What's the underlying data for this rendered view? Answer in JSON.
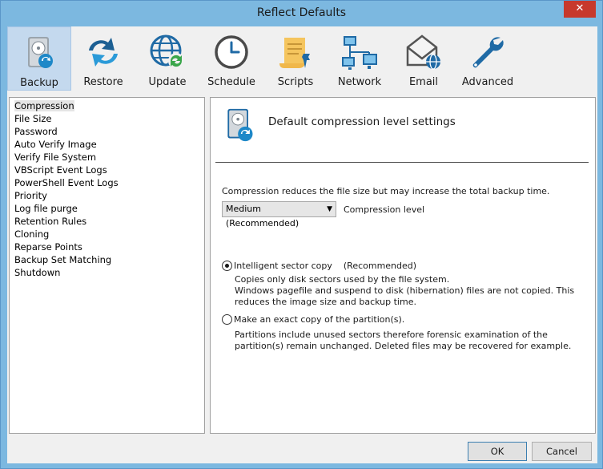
{
  "window": {
    "title": "Reflect Defaults",
    "close_glyph": "✕"
  },
  "toolbar": [
    {
      "label": "Backup",
      "icon": "backup-disk-icon",
      "active": true
    },
    {
      "label": "Restore",
      "icon": "restore-arrows-icon"
    },
    {
      "label": "Update",
      "icon": "update-globe-icon"
    },
    {
      "label": "Schedule",
      "icon": "clock-icon"
    },
    {
      "label": "Scripts",
      "icon": "script-scroll-icon"
    },
    {
      "label": "Network",
      "icon": "network-icon"
    },
    {
      "label": "Email",
      "icon": "email-envelope-icon"
    },
    {
      "label": "Advanced",
      "icon": "wrench-icon"
    }
  ],
  "tree": [
    "Compression",
    "File Size",
    "Password",
    "Auto Verify Image",
    "Verify File System",
    "VBScript Event Logs",
    "PowerShell Event Logs",
    "Priority",
    "Log file purge",
    "Retention Rules",
    "Cloning",
    "Reparse Points",
    "Backup Set Matching",
    "Shutdown"
  ],
  "panel": {
    "title": "Default compression level settings",
    "description": "Compression reduces the file size but may increase the total backup time.",
    "compression": {
      "selected": "Medium (Recommended)",
      "caption": "Compression level"
    },
    "option1": {
      "label": "Intelligent sector copy",
      "note": "(Recommended)",
      "desc1": "Copies only disk sectors used by the file system.",
      "desc2": "Windows pagefile and suspend to disk (hibernation) files are not copied. This reduces the image size and backup time."
    },
    "option2": {
      "label": "Make an exact copy of the partition(s).",
      "desc": "Partitions include unused sectors therefore forensic examination of the partition(s) remain unchanged. Deleted files may be recovered for example."
    }
  },
  "buttons": {
    "ok": "OK",
    "cancel": "Cancel"
  }
}
